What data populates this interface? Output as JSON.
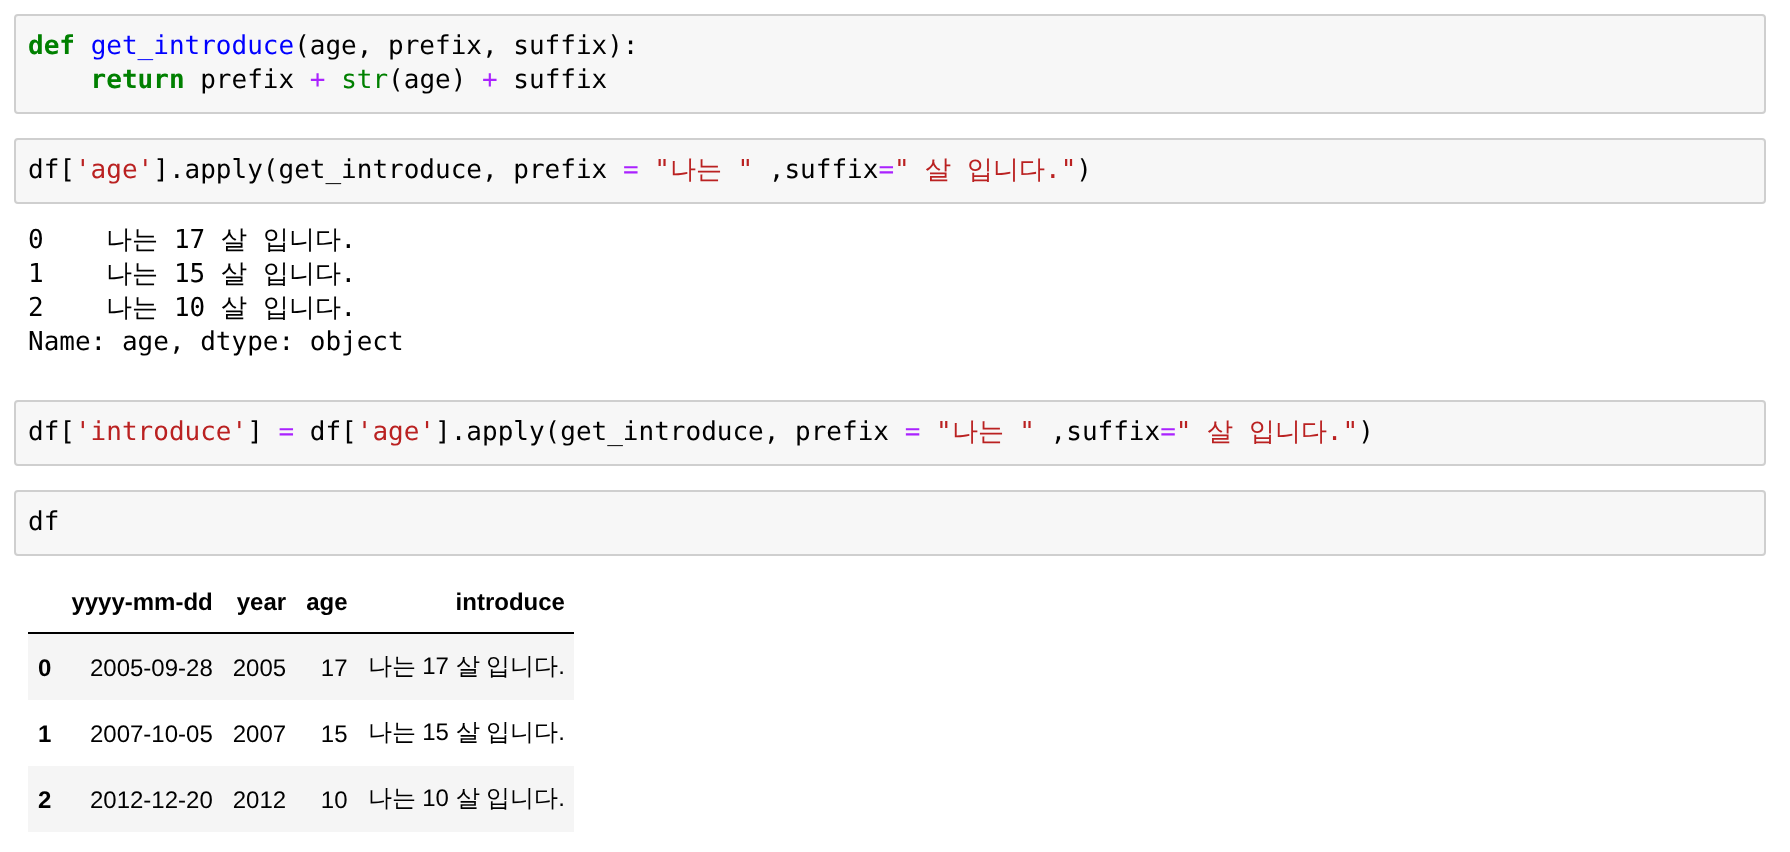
{
  "cells": [
    {
      "kind": "code",
      "lines": [
        [
          {
            "kind": "keyword",
            "text": "def "
          },
          {
            "kind": "function",
            "text": "get_introduce"
          },
          {
            "kind": "plain",
            "text": "(age, prefix, suffix):"
          }
        ],
        [
          {
            "kind": "keyword",
            "text": "    return"
          },
          {
            "kind": "plain",
            "text": " prefix "
          },
          {
            "kind": "operator",
            "text": "+ "
          },
          {
            "kind": "builtin",
            "text": "str"
          },
          {
            "kind": "plain",
            "text": "(age) "
          },
          {
            "kind": "operator",
            "text": "+"
          },
          {
            "kind": "plain",
            "text": " suffix"
          }
        ]
      ]
    },
    {
      "kind": "code",
      "lines": [
        [
          {
            "kind": "plain",
            "text": "df["
          },
          {
            "kind": "string",
            "text": "'age'"
          },
          {
            "kind": "plain",
            "text": "].apply(get_introduce, prefix "
          },
          {
            "kind": "operator",
            "text": "= "
          },
          {
            "kind": "string",
            "text": "\"나는 \""
          },
          {
            "kind": "plain",
            "text": " ,suffix"
          },
          {
            "kind": "operator",
            "text": "="
          },
          {
            "kind": "string",
            "text": "\" 살 입니다.\""
          },
          {
            "kind": "plain",
            "text": ")"
          }
        ]
      ]
    },
    {
      "kind": "output",
      "lines": [
        "0    나는 17 살 입니다.",
        "1    나는 15 살 입니다.",
        "2    나는 10 살 입니다.",
        "Name: age, dtype: object"
      ]
    },
    {
      "kind": "code",
      "lines": [
        [
          {
            "kind": "plain",
            "text": "df["
          },
          {
            "kind": "string",
            "text": "'introduce'"
          },
          {
            "kind": "plain",
            "text": "] "
          },
          {
            "kind": "operator",
            "text": "="
          },
          {
            "kind": "plain",
            "text": " df["
          },
          {
            "kind": "string",
            "text": "'age'"
          },
          {
            "kind": "plain",
            "text": "].apply(get_introduce, prefix "
          },
          {
            "kind": "operator",
            "text": "= "
          },
          {
            "kind": "string",
            "text": "\"나는 \""
          },
          {
            "kind": "plain",
            "text": " ,suffix"
          },
          {
            "kind": "operator",
            "text": "="
          },
          {
            "kind": "string",
            "text": "\" 살 입니다.\""
          },
          {
            "kind": "plain",
            "text": ")"
          }
        ]
      ]
    },
    {
      "kind": "code",
      "lines": [
        [
          {
            "kind": "plain",
            "text": "df"
          }
        ]
      ]
    },
    {
      "kind": "table",
      "columns": [
        "yyyy-mm-dd",
        "year",
        "age",
        "introduce"
      ],
      "rows": [
        {
          "index": "0",
          "cells": [
            "2005-09-28",
            "2005",
            "17",
            "나는 17 살 입니다."
          ]
        },
        {
          "index": "1",
          "cells": [
            "2007-10-05",
            "2007",
            "15",
            "나는 15 살 입니다."
          ]
        },
        {
          "index": "2",
          "cells": [
            "2012-12-20",
            "2012",
            "10",
            "나는 10 살 입니다."
          ]
        }
      ]
    }
  ]
}
